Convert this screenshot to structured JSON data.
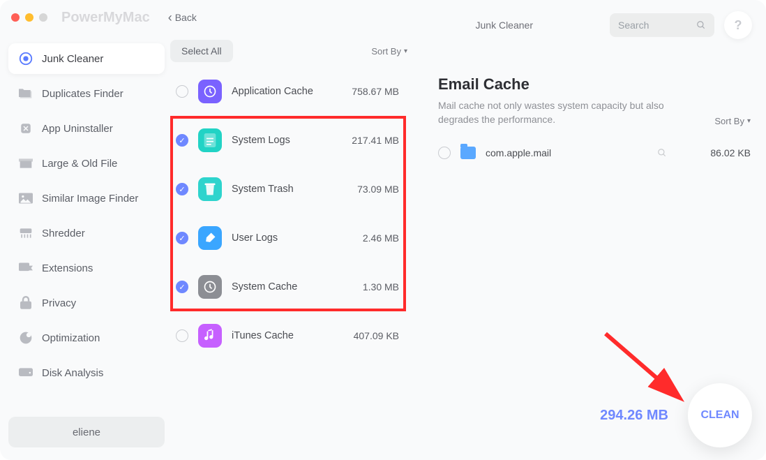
{
  "app_name": "PowerMyMac",
  "back_label": "Back",
  "section_label": "Junk Cleaner",
  "search": {
    "placeholder": "Search"
  },
  "help_label": "?",
  "sidebar": {
    "items": [
      {
        "label": "Junk Cleaner",
        "active": true,
        "icon": "target"
      },
      {
        "label": "Duplicates Finder",
        "active": false,
        "icon": "folders"
      },
      {
        "label": "App Uninstaller",
        "active": false,
        "icon": "uninstall"
      },
      {
        "label": "Large & Old File",
        "active": false,
        "icon": "box"
      },
      {
        "label": "Similar Image Finder",
        "active": false,
        "icon": "image"
      },
      {
        "label": "Shredder",
        "active": false,
        "icon": "shredder"
      },
      {
        "label": "Extensions",
        "active": false,
        "icon": "ext"
      },
      {
        "label": "Privacy",
        "active": false,
        "icon": "lock"
      },
      {
        "label": "Optimization",
        "active": false,
        "icon": "opt"
      },
      {
        "label": "Disk Analysis",
        "active": false,
        "icon": "disk"
      }
    ],
    "user": "eliene"
  },
  "mid": {
    "select_all": "Select All",
    "sort_label": "Sort By",
    "items": [
      {
        "name": "Application Cache",
        "size": "758.67 MB",
        "checked": false,
        "color": "#7a62ff",
        "icon": "clock"
      },
      {
        "name": "System Logs",
        "size": "217.41 MB",
        "checked": true,
        "color": "#22d3c5",
        "icon": "doc"
      },
      {
        "name": "System Trash",
        "size": "73.09 MB",
        "checked": true,
        "color": "#2ed4cd",
        "icon": "trash"
      },
      {
        "name": "User Logs",
        "size": "2.46 MB",
        "checked": true,
        "color": "#3aa6ff",
        "icon": "brush"
      },
      {
        "name": "System Cache",
        "size": "1.30 MB",
        "checked": true,
        "color": "#8c8e94",
        "icon": "clock"
      },
      {
        "name": "iTunes Cache",
        "size": "407.09 KB",
        "checked": false,
        "color": "#c660ff",
        "icon": "music"
      }
    ],
    "highlight": {
      "from": 1,
      "to": 4
    }
  },
  "right": {
    "title": "Email Cache",
    "desc": "Mail cache not only wastes system capacity but also degrades the performance.",
    "sort_label": "Sort By",
    "items": [
      {
        "name": "com.apple.mail",
        "size": "86.02 KB",
        "checked": false
      }
    ]
  },
  "footer": {
    "total": "294.26 MB",
    "clean_label": "CLEAN"
  }
}
